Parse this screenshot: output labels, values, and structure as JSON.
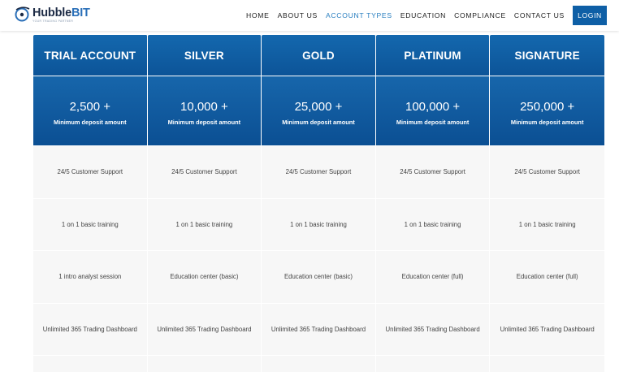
{
  "brand": {
    "name_part1": "Hubble",
    "name_part2": "BIT",
    "tagline": "Your Trading Partner"
  },
  "nav": {
    "items": [
      {
        "label": "HOME",
        "active": false
      },
      {
        "label": "ABOUT US",
        "active": false
      },
      {
        "label": "ACCOUNT TYPES",
        "active": true
      },
      {
        "label": "EDUCATION",
        "active": false
      },
      {
        "label": "COMPLIANCE",
        "active": false
      },
      {
        "label": "CONTACT US",
        "active": false
      }
    ],
    "login_label": "LOGIN"
  },
  "colors": {
    "accent": "#2a7fc0",
    "header_blue": "#0e5fa6",
    "cell_bg": "#f7f7f7"
  },
  "plans": [
    {
      "name": "TRIAL ACCOUNT",
      "amount": "2,500 +",
      "amount_label": "Minimum deposit amount",
      "features": [
        "24/5 Customer Support",
        "1 on 1 basic training",
        "1 intro analyst session",
        "Unlimited 365 Trading Dashboard",
        ""
      ]
    },
    {
      "name": "SILVER",
      "amount": "10,000 +",
      "amount_label": "Minimum deposit amount",
      "features": [
        "24/5 Customer Support",
        "1 on 1 basic training",
        "Education center (basic)",
        "Unlimited 365 Trading Dashboard",
        ""
      ]
    },
    {
      "name": "GOLD",
      "amount": "25,000 +",
      "amount_label": "Minimum deposit amount",
      "features": [
        "24/5 Customer Support",
        "1 on 1 basic training",
        "Education center (basic)",
        "Unlimited 365 Trading Dashboard",
        ""
      ]
    },
    {
      "name": "PLATINUM",
      "amount": "100,000 +",
      "amount_label": "Minimum deposit amount",
      "features": [
        "24/5 Customer Support",
        "1 on 1 basic training",
        "Education center (full)",
        "Unlimited 365 Trading Dashboard",
        ""
      ]
    },
    {
      "name": "SIGNATURE",
      "amount": "250,000 +",
      "amount_label": "Minimum deposit amount",
      "features": [
        "24/5 Customer Support",
        "1 on 1 basic training",
        "Education center (full)",
        "Unlimited 365 Trading Dashboard",
        ""
      ]
    }
  ]
}
